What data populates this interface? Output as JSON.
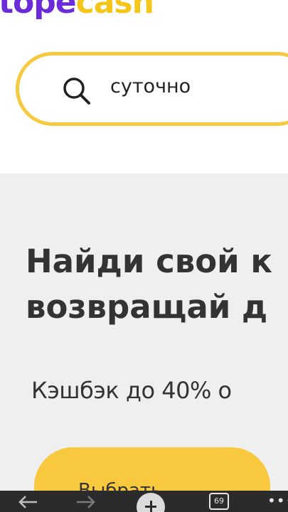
{
  "header": {
    "logo": {
      "part1": "tope",
      "part2": "cash"
    },
    "search": {
      "query": "суточно",
      "icon": "search-icon"
    }
  },
  "hero": {
    "title_line1": "Найди свой к",
    "title_line2": "возвращай д",
    "subtitle": "Кэшбэк до 40% о",
    "cta_label": "Выбрать"
  },
  "toolbar": {
    "back_icon": "back-arrow-icon",
    "forward_icon": "forward-arrow-icon",
    "new_tab_icon": "plus-icon",
    "tab_count": "69",
    "more_icon": "more-icon"
  },
  "colors": {
    "accent_yellow": "#f8c93f",
    "brand_purple": "#6b2bd9",
    "hero_bg": "#efefef",
    "toolbar_bg": "#2b2b2b"
  }
}
